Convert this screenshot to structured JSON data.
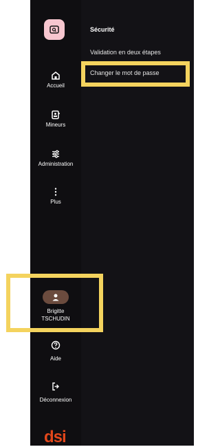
{
  "nav": {
    "home": "Accueil",
    "minors": "Mineurs",
    "admin": "Administration",
    "more": "Plus",
    "user_first": "Brigitte",
    "user_last": "TSCHUDIN",
    "help": "Aide",
    "logout": "Déconnexion"
  },
  "panel": {
    "title": "Sécurité",
    "items": [
      "Validation en deux étapes",
      "Changer le mot de passe"
    ]
  },
  "brand": "dsi",
  "colors": {
    "highlight": "#f4d35e",
    "logo_bg": "#f7c6cf",
    "avatar_bg": "#6b4b3e",
    "brand": "#e3471b"
  },
  "icons": [
    "app-logo-icon",
    "home-icon",
    "contacts-icon",
    "sliders-icon",
    "more-icon",
    "user-icon",
    "help-icon",
    "logout-icon"
  ]
}
